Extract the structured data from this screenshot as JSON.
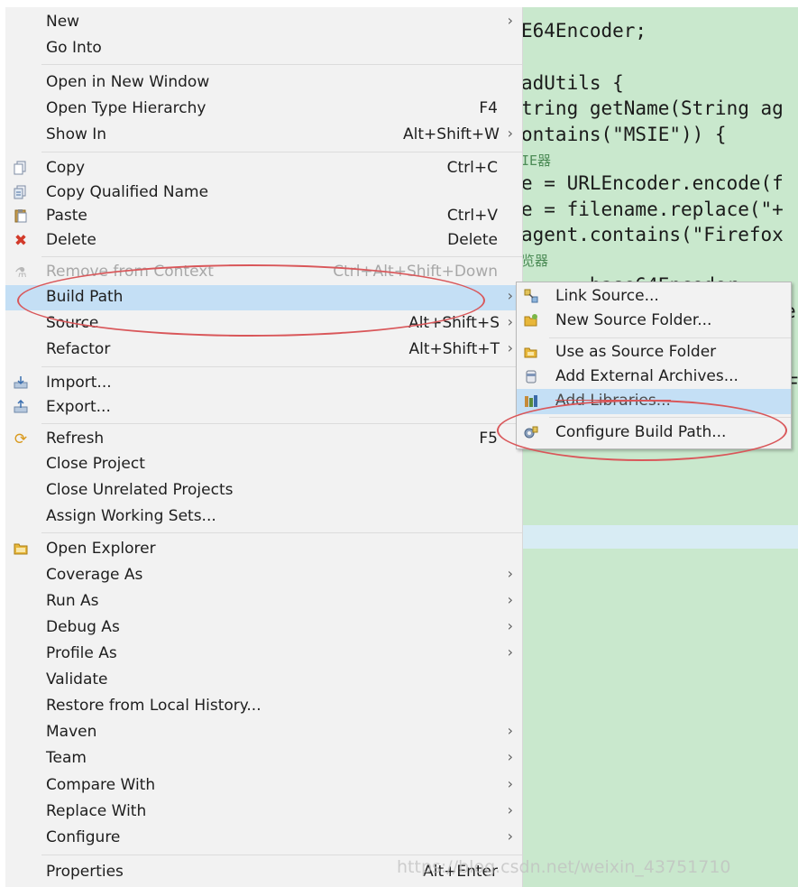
{
  "editor": {
    "lines": [
      "E64Encoder;",
      "adUtils {",
      "tring getName(String ag",
      "ontains(\"MSIE\")) {",
      "IE器",
      "e = URLEncoder.encode(f",
      "e = filename.replace(\"+",
      "agent.contains(\"Firefox",
      "览器",
      "      base64Encoder",
      "e",
      "F"
    ]
  },
  "main_menu": {
    "new": {
      "label": "New"
    },
    "go_into": {
      "label": "Go Into"
    },
    "open_new_window": {
      "label": "Open in New Window"
    },
    "open_type_hierarchy": {
      "label": "Open Type Hierarchy",
      "shortcut": "F4"
    },
    "show_in": {
      "label": "Show In",
      "shortcut": "Alt+Shift+W"
    },
    "copy": {
      "label": "Copy",
      "shortcut": "Ctrl+C",
      "icon": "copy-icon"
    },
    "copy_qualified_name": {
      "label": "Copy Qualified Name",
      "icon": "copy-qualified-name-icon"
    },
    "paste": {
      "label": "Paste",
      "shortcut": "Ctrl+V",
      "icon": "paste-icon"
    },
    "delete": {
      "label": "Delete",
      "shortcut": "Delete",
      "icon": "delete-icon"
    },
    "remove_from_context": {
      "label": "Remove from Context",
      "shortcut": "Ctrl+Alt+Shift+Down",
      "icon": "remove-from-context-icon"
    },
    "build_path": {
      "label": "Build Path"
    },
    "source": {
      "label": "Source",
      "shortcut": "Alt+Shift+S"
    },
    "refactor": {
      "label": "Refactor",
      "shortcut": "Alt+Shift+T"
    },
    "import": {
      "label": "Import...",
      "icon": "import-icon"
    },
    "export": {
      "label": "Export...",
      "icon": "export-icon"
    },
    "refresh": {
      "label": "Refresh",
      "shortcut": "F5",
      "icon": "refresh-icon"
    },
    "close_project": {
      "label": "Close Project"
    },
    "close_unrelated": {
      "label": "Close Unrelated Projects"
    },
    "assign_working_sets": {
      "label": "Assign Working Sets..."
    },
    "open_explorer": {
      "label": "Open Explorer",
      "icon": "folder-icon"
    },
    "coverage_as": {
      "label": "Coverage As"
    },
    "run_as": {
      "label": "Run As"
    },
    "debug_as": {
      "label": "Debug As"
    },
    "profile_as": {
      "label": "Profile As"
    },
    "validate": {
      "label": "Validate"
    },
    "restore_local_history": {
      "label": "Restore from Local History..."
    },
    "maven": {
      "label": "Maven"
    },
    "team": {
      "label": "Team"
    },
    "compare_with": {
      "label": "Compare With"
    },
    "replace_with": {
      "label": "Replace With"
    },
    "configure": {
      "label": "Configure"
    },
    "properties": {
      "label": "Properties",
      "shortcut": "Alt+Enter"
    }
  },
  "sub_menu": {
    "link_source": {
      "label": "Link Source...",
      "icon": "link-source-icon"
    },
    "new_source_folder": {
      "label": "New Source Folder...",
      "icon": "new-source-folder-icon"
    },
    "use_as_source_folder": {
      "label": "Use as Source Folder",
      "icon": "use-as-source-folder-icon"
    },
    "add_external_archives": {
      "label": "Add External Archives...",
      "icon": "jar-icon"
    },
    "add_libraries": {
      "label": "Add Libraries...",
      "icon": "library-icon"
    },
    "configure_build_path": {
      "label": "Configure Build Path...",
      "icon": "configure-build-path-icon"
    }
  },
  "watermark": "https://blog.csdn.net/weixin_43751710",
  "colors": {
    "menu_bg": "#f2f2f2",
    "selection": "#c4dff5",
    "editor_bg": "#c9e8cd",
    "annotation": "#d9575a",
    "string_literal": "#2a00ff"
  }
}
